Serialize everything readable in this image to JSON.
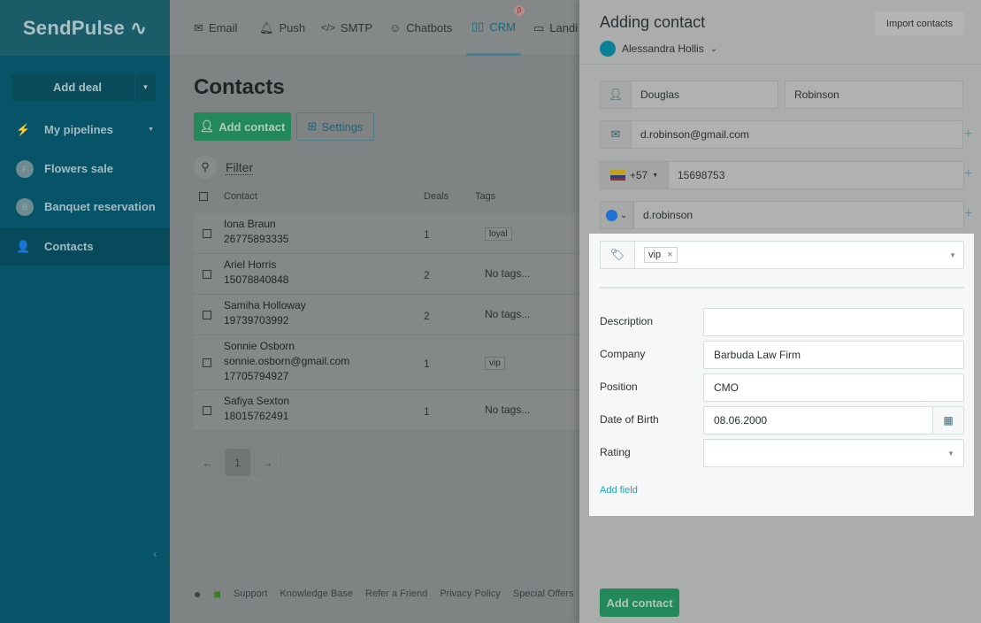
{
  "app": {
    "logo": "SendPulse"
  },
  "sidebar": {
    "add_deal": "Add deal",
    "items": [
      {
        "label": "My pipelines",
        "icon": "pipeline-icon"
      },
      {
        "label": "Flowers sale",
        "initial": "F"
      },
      {
        "label": "Banquet reservation",
        "initial": "B"
      },
      {
        "label": "Contacts",
        "icon": "contacts-icon"
      }
    ]
  },
  "nav": {
    "tabs": [
      {
        "label": "Email",
        "icon": "envelope-icon"
      },
      {
        "label": "Push",
        "icon": "bell-icon"
      },
      {
        "label": "SMTP",
        "icon": "code-icon"
      },
      {
        "label": "Chatbots",
        "icon": "chat-icon"
      },
      {
        "label": "CRM",
        "icon": "crm-icon",
        "active": true,
        "badge": "β"
      },
      {
        "label": "Landi",
        "icon": "landing-icon"
      }
    ]
  },
  "main": {
    "title": "Contacts",
    "add_contact": "Add contact",
    "settings": "Settings",
    "filter": "Filter",
    "columns": [
      "Contact",
      "Deals",
      "Tags"
    ],
    "rows": [
      {
        "name": "Iona Braun",
        "lines": [
          "26775893335"
        ],
        "deals": "1",
        "tag": "loyal"
      },
      {
        "name": "Ariel Horris",
        "lines": [
          "15078840848"
        ],
        "deals": "2",
        "tag": "No tags..."
      },
      {
        "name": "Samiha Holloway",
        "lines": [
          "19739703992"
        ],
        "deals": "2",
        "tag": "No tags..."
      },
      {
        "name": "Sonnie Osborn",
        "lines": [
          "sonnie.osborn@gmail.com",
          "17705794927"
        ],
        "deals": "1",
        "tag": "vip"
      },
      {
        "name": "Safiya Sexton",
        "lines": [
          "18015762491"
        ],
        "deals": "1",
        "tag": "No tags..."
      }
    ],
    "pagination": {
      "prev": "←",
      "page": "1",
      "next": "→"
    },
    "footer": [
      "Support",
      "Knowledge Base",
      "Refer a Friend",
      "Privacy Policy",
      "Special Offers"
    ]
  },
  "panel": {
    "title": "Adding contact",
    "import": "Import contacts",
    "owner": "Alessandra Hollis",
    "first_name": "Douglas",
    "last_name": "Robinson",
    "email": "d.robinson@gmail.com",
    "phone_code": "+57",
    "phone": "15698753",
    "messenger": "d.robinson",
    "tags": [
      "vip"
    ],
    "fields": [
      {
        "label": "Description",
        "value": ""
      },
      {
        "label": "Company",
        "value": "Barbuda Law Firm"
      },
      {
        "label": "Position",
        "value": "CMO"
      },
      {
        "label": "Date of Birth",
        "value": "08.06.2000"
      },
      {
        "label": "Rating",
        "value": ""
      }
    ],
    "add_field": "Add field",
    "submit": "Add contact"
  },
  "colors": {
    "accent": "#1aa3b8",
    "green": "#23885a",
    "sidebar": "#075468"
  }
}
